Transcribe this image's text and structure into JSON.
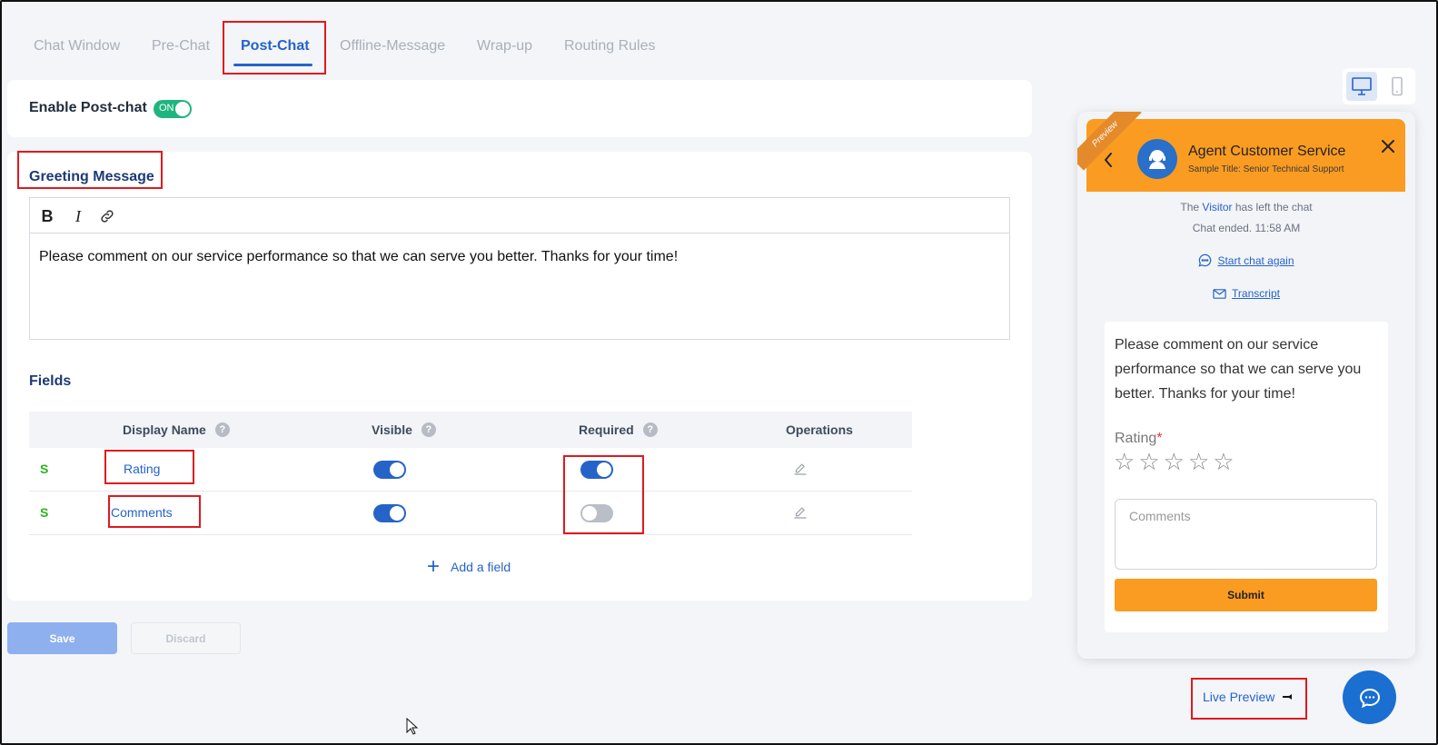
{
  "tabs": [
    {
      "label": "Chat Window"
    },
    {
      "label": "Pre-Chat"
    },
    {
      "label": "Post-Chat"
    },
    {
      "label": "Offline-Message"
    },
    {
      "label": "Wrap-up"
    },
    {
      "label": "Routing Rules"
    }
  ],
  "active_tab": "Post-Chat",
  "enable": {
    "label": "Enable Post-chat",
    "toggle_text": "ON"
  },
  "greeting": {
    "title": "Greeting Message",
    "toolbar": {
      "bold": "B",
      "italic": "I"
    },
    "text": "Please comment on our service performance so that we can serve you better. Thanks for your time!"
  },
  "fields": {
    "title": "Fields",
    "columns": {
      "display_name": "Display Name",
      "visible": "Visible",
      "required": "Required",
      "operations": "Operations"
    },
    "help_glyph": "?",
    "rows": [
      {
        "icon_text": "S",
        "name": "Rating",
        "visible": true,
        "required": true
      },
      {
        "icon_text": "S",
        "name": "Comments",
        "visible": true,
        "required": false
      }
    ],
    "add_label": "Add a field",
    "add_glyph": "+"
  },
  "actions": {
    "save": "Save",
    "discard": "Discard"
  },
  "preview": {
    "ribbon": "Preview",
    "agent_name": "Agent Customer Service",
    "agent_subtitle": "Sample Title: Senior Technical Support",
    "left_prefix": "The ",
    "left_visitor": "Visitor",
    "left_suffix": " has left the chat",
    "chat_ended": "Chat ended. 11:58 AM",
    "start_again": "Start chat again",
    "transcript": "Transcript",
    "greeting": "Please comment on our service performance so that we can serve you better. Thanks for your time!",
    "rating_label": "Rating",
    "required_mark": "*",
    "stars": [
      "☆",
      "☆",
      "☆",
      "☆",
      "☆"
    ],
    "comments_placeholder": "Comments",
    "submit": "Submit"
  },
  "live_preview": "Live Preview",
  "colors": {
    "accent": "#2563c9",
    "orange": "#fa9c21",
    "on_green": "#1fb57e",
    "highlight": "#e0191e"
  },
  "icons": [
    "desktop-icon",
    "mobile-icon",
    "link-icon",
    "edit-icon",
    "chevron-left-icon",
    "close-icon",
    "chat-bubble-icon",
    "mail-icon",
    "agent-avatar-icon",
    "chat-fab-icon",
    "mouse-cursor-icon"
  ]
}
